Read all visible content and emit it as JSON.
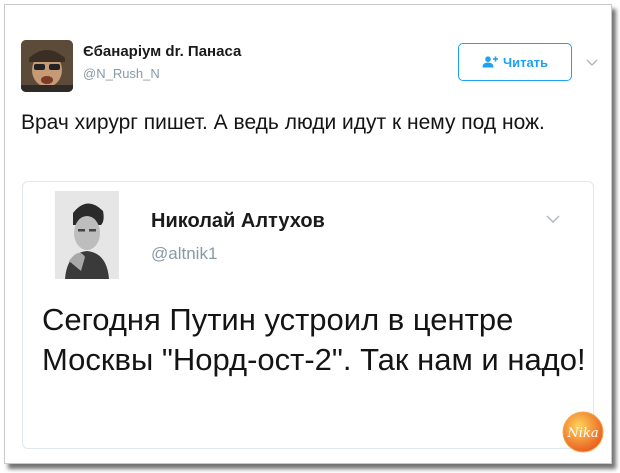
{
  "tweet": {
    "display_name": "Єбанаріум dr. Панаса",
    "handle": "@N_Rush_N",
    "follow_label": "Читать",
    "text": "Врач хирург пишет. А ведь люди идут к нему под нож.",
    "icons": {
      "follow": "add-user-icon",
      "menu": "chevron-down-icon"
    }
  },
  "quoted_tweet": {
    "display_name": "Николай Алтухов",
    "handle": "@altnik1",
    "text": "Сегодня Путин устроил в центре Москвы \"Норд-ост-2\". Так нам и надо!",
    "icons": {
      "menu": "chevron-down-icon"
    }
  },
  "watermark": {
    "text": "Nika",
    "colors": [
      "#f7b733",
      "#e8581c"
    ]
  },
  "colors": {
    "accent": "#1da1f2",
    "secondary_text": "#8899a6",
    "border": "#e1e8ed"
  }
}
